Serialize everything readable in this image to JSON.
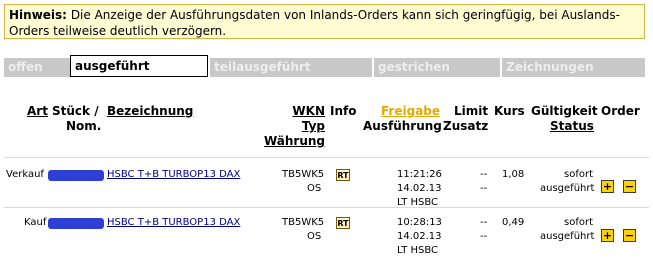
{
  "hint": {
    "label": "Hinweis:",
    "text": "Die Anzeige der Ausführungsdaten von Inlands-Orders kann sich geringfügig, bei Auslands-Orders teilweise deutlich verzögern."
  },
  "tabs": [
    {
      "label": "offen"
    },
    {
      "label": "ausgeführt"
    },
    {
      "label": "teilausgeführt"
    },
    {
      "label": "gestrichen"
    },
    {
      "label": "Zeichnungen"
    }
  ],
  "columns": {
    "art": "Art",
    "stueck": "Stück /",
    "nom": "Nom.",
    "bezeichnung": "Bezeichnung",
    "wkn": "WKN",
    "typ": "Typ",
    "waehrung": "Währung",
    "info": "Info",
    "freigabe": "Freigabe",
    "ausfuehrung": "Ausführung",
    "limit": "Limit",
    "zusatz": "Zusatz",
    "kurs": "Kurs",
    "gueltigkeit": "Gültigkeit",
    "status": "Status",
    "order": "Order"
  },
  "rows": [
    {
      "art": "Verkauf",
      "bezeichnung": "HSBC T+B TURBOP13 DAX",
      "wkn": "TB5WK5",
      "typ": "OS",
      "info_icon": "RT",
      "time": "11:21:26",
      "date": "14.02.13",
      "venue": "LT HSBC",
      "limit": "--",
      "zusatz": "--",
      "kurs": "1,08",
      "gueltigkeit": "sofort",
      "status": "ausgeführt",
      "plus": "+",
      "minus": "−"
    },
    {
      "art": "Kauf",
      "bezeichnung": "HSBC T+B TURBOP13 DAX",
      "wkn": "TB5WK5",
      "typ": "OS",
      "info_icon": "RT",
      "time": "10:28:13",
      "date": "14.02.13",
      "venue": "LT HSBC",
      "limit": "--",
      "zusatz": "--",
      "kurs": "0,49",
      "gueltigkeit": "sofort",
      "status": "ausgeführt",
      "plus": "+",
      "minus": "−"
    }
  ],
  "colors": {
    "hint_bg": "#fffbd2",
    "tab_bg": "#c8c8c8",
    "freigabe": "#e8a800",
    "mask": "#2f3fd6",
    "button": "#ffd200"
  }
}
